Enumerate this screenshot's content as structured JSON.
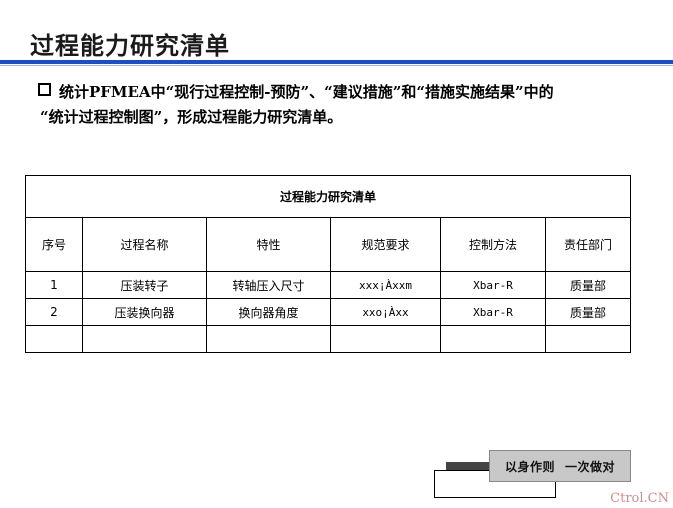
{
  "header": {
    "title": "过程能力研究清单"
  },
  "intro": {
    "line1": "统计PFMEA中“现行过程控制-预防”、“建议措施”和“措施实施结果”中的",
    "line2": "“统计过程控制图”，形成过程能力研究清单。"
  },
  "table": {
    "caption": "过程能力研究清单",
    "columns": [
      "序号",
      "过程名称",
      "特性",
      "规范要求",
      "控制方法",
      "责任部门"
    ],
    "rows": [
      [
        "1",
        "压装转子",
        "转轴压入尺寸",
        "xxx¡Àxxm",
        "Xbar-R",
        "质量部"
      ],
      [
        "2",
        "压装换向器",
        "换向器角度",
        "xxo¡Àxx",
        "Xbar-R",
        "质量部"
      ]
    ]
  },
  "badge": {
    "part1": "以身作则",
    "part2": "一次做对"
  },
  "watermark": "Ctrol.CN"
}
